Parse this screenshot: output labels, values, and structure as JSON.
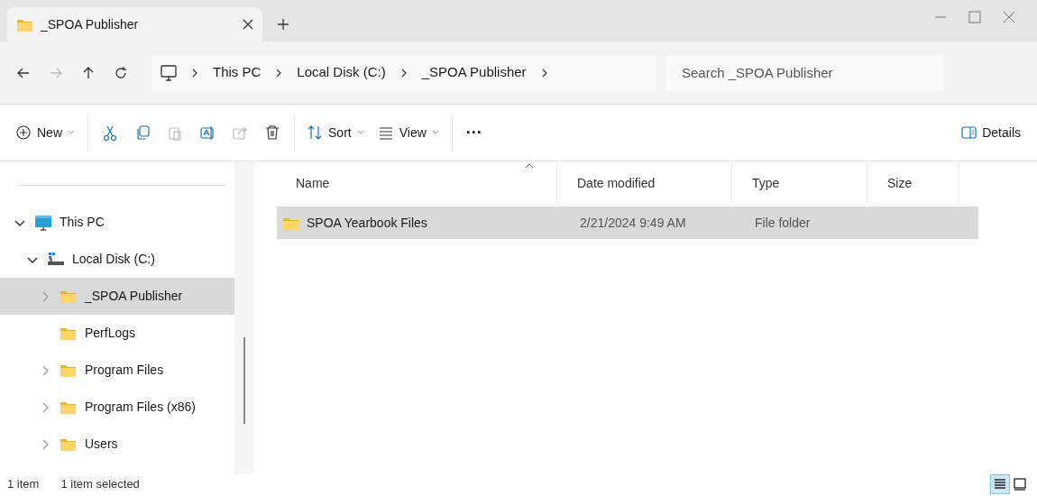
{
  "tabs": [
    {
      "title": "_SPOA Publisher",
      "selected": true
    }
  ],
  "nav": [
    {
      "kind": "back",
      "disabled": false
    },
    {
      "kind": "forward",
      "disabled": true
    },
    {
      "kind": "up",
      "disabled": false
    },
    {
      "kind": "refresh",
      "disabled": false
    }
  ],
  "breadcrumb": [
    "This PC",
    "Local Disk (C:)",
    "_SPOA Publisher"
  ],
  "search": {
    "placeholder": "Search _SPOA Publisher"
  },
  "toolbar": [
    {
      "kind": "new",
      "label": "New",
      "disabled": false
    },
    {
      "kind": "cut",
      "disabled": false
    },
    {
      "kind": "copy",
      "disabled": false
    },
    {
      "kind": "paste",
      "disabled": true
    },
    {
      "kind": "rename",
      "disabled": false
    },
    {
      "kind": "share",
      "disabled": true
    },
    {
      "kind": "delete",
      "disabled": false
    },
    {
      "kind": "sort",
      "label": "Sort",
      "disabled": false
    },
    {
      "kind": "view",
      "label": "View",
      "disabled": false
    },
    {
      "kind": "more",
      "label": "···",
      "disabled": false
    },
    {
      "kind": "details",
      "label": "Details",
      "disabled": false
    }
  ],
  "sidebar": {
    "items": [
      {
        "label": "This PC",
        "kind": "pc",
        "expandable": true,
        "expanded": true,
        "selected": false,
        "children": [
          {
            "label": "Local Disk (C:)",
            "kind": "drive",
            "expandable": true,
            "expanded": true,
            "selected": false,
            "children": [
              {
                "label": "_SPOA Publisher",
                "kind": "folder",
                "expandable": true,
                "expanded": false,
                "selected": true
              },
              {
                "label": "PerfLogs",
                "kind": "folder",
                "expandable": false,
                "selected": false
              },
              {
                "label": "Program Files",
                "kind": "folder",
                "expandable": true,
                "expanded": false,
                "selected": false
              },
              {
                "label": "Program Files (x86)",
                "kind": "folder",
                "expandable": true,
                "expanded": false,
                "selected": false
              },
              {
                "label": "Users",
                "kind": "folder",
                "expandable": true,
                "expanded": false,
                "selected": false
              }
            ]
          }
        ]
      }
    ]
  },
  "table": {
    "columns": [
      "Name",
      "Date modified",
      "Type",
      "Size"
    ],
    "rows": [
      {
        "name": "SPOA Yearbook Files",
        "date_modified": "2/21/2024 9:49 AM",
        "type": "File folder",
        "selected": true
      }
    ]
  },
  "status_bar": {
    "count": "1 item",
    "selection": "1 item selected"
  },
  "view_modes": [
    {
      "kind": "details",
      "selected": true
    },
    {
      "kind": "tiles",
      "selected": false
    }
  ]
}
